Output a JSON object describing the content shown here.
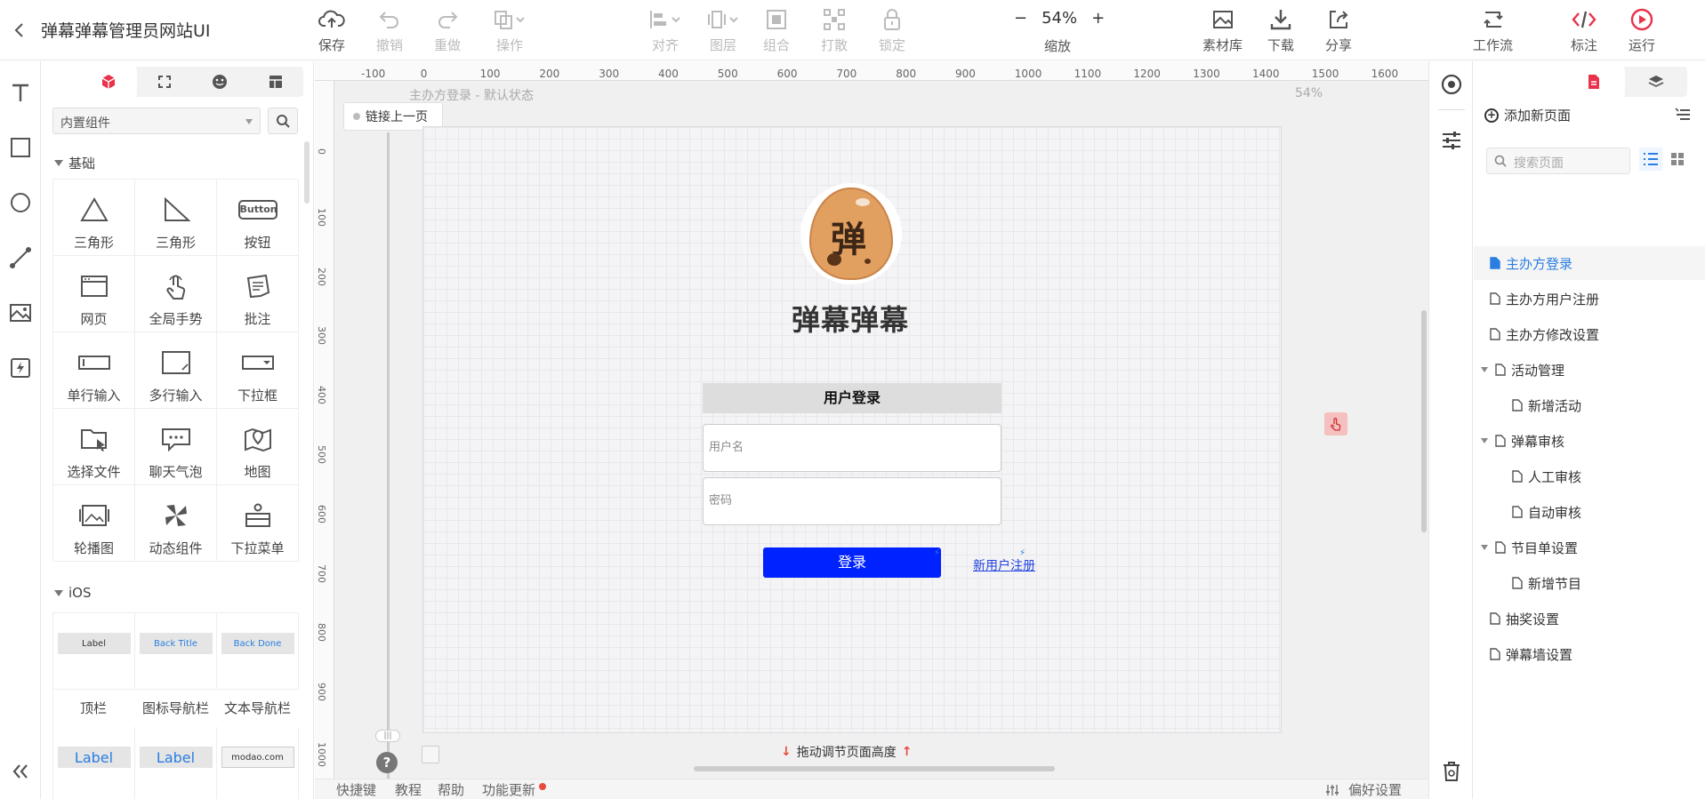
{
  "header": {
    "title": "弹幕弹幕管理员网站UI",
    "save": "保存",
    "undo": "撤销",
    "redo": "重做",
    "operate": "操作",
    "align": "对齐",
    "layer": "图层",
    "group": "组合",
    "ungroup": "打散",
    "lock": "锁定",
    "zoom_value": "54%",
    "zoom_label": "缩放",
    "assets": "素材库",
    "download": "下载",
    "share": "分享",
    "workflow": "工作流",
    "annotate": "标注",
    "run": "运行",
    "minus": "−",
    "plus": "+"
  },
  "library": {
    "select_value": "内置组件",
    "section_basic": "基础",
    "items": [
      {
        "label": "三角形",
        "icon": "triangle-icon"
      },
      {
        "label": "三角形",
        "icon": "right-triangle-icon"
      },
      {
        "label": "按钮",
        "icon": "button-icon"
      },
      {
        "label": "网页",
        "icon": "webpage-icon"
      },
      {
        "label": "全局手势",
        "icon": "gesture-icon"
      },
      {
        "label": "批注",
        "icon": "note-icon"
      },
      {
        "label": "单行输入",
        "icon": "input-icon"
      },
      {
        "label": "多行输入",
        "icon": "textarea-icon"
      },
      {
        "label": "下拉框",
        "icon": "select-icon"
      },
      {
        "label": "选择文件",
        "icon": "file-icon"
      },
      {
        "label": "聊天气泡",
        "icon": "chat-bubble-icon"
      },
      {
        "label": "地图",
        "icon": "map-icon"
      },
      {
        "label": "轮播图",
        "icon": "carousel-icon"
      },
      {
        "label": "动态组件",
        "icon": "dynamic-icon"
      },
      {
        "label": "下拉菜单",
        "icon": "dropdown-menu-icon"
      }
    ],
    "button_preview": "Button",
    "section_ios": "iOS",
    "ios_items": [
      {
        "label": "顶栏",
        "preview": "Label"
      },
      {
        "label": "图标导航栏",
        "preview": "Back  Title"
      },
      {
        "label": "文本导航栏",
        "preview": "Back  Done"
      }
    ],
    "ios_label_a": "Label",
    "ios_url": "modao.com"
  },
  "canvas": {
    "page_label": "主办方登录 - 默认状态",
    "page_zoom": "54%",
    "link_prev": "链接上一页",
    "hruler": [
      "-100",
      "0",
      "100",
      "200",
      "300",
      "400",
      "500",
      "600",
      "700",
      "800",
      "900",
      "1000",
      "1100",
      "1200",
      "1300",
      "1400",
      "1500",
      "1600"
    ],
    "vruler": [
      "0",
      "100",
      "200",
      "300",
      "400",
      "500",
      "600",
      "700",
      "800",
      "900",
      "1000"
    ],
    "brand": "弹幕弹幕",
    "logo_char": "弹",
    "login_header": "用户登录",
    "username_placeholder": "用户名",
    "password_placeholder": "密码",
    "login_button": "登录",
    "register_link": "新用户注册",
    "drag_tip": "拖动调节页面高度"
  },
  "bottombar": {
    "shortcuts": "快捷键",
    "tutorial": "教程",
    "help": "帮助",
    "updates": "功能更新",
    "prefs": "偏好设置"
  },
  "pages": {
    "add_page": "添加新页面",
    "search_placeholder": "搜索页面",
    "items": [
      {
        "label": "主办方登录",
        "level": 0,
        "selected": true,
        "group": false
      },
      {
        "label": "主办方用户注册",
        "level": 0,
        "selected": false,
        "group": false
      },
      {
        "label": "主办方修改设置",
        "level": 0,
        "selected": false,
        "group": false
      },
      {
        "label": "活动管理",
        "level": 0,
        "selected": false,
        "group": true
      },
      {
        "label": "新增活动",
        "level": 1,
        "selected": false,
        "group": false
      },
      {
        "label": "弹幕审核",
        "level": 0,
        "selected": false,
        "group": true
      },
      {
        "label": "人工审核",
        "level": 1,
        "selected": false,
        "group": false
      },
      {
        "label": "自动审核",
        "level": 1,
        "selected": false,
        "group": false
      },
      {
        "label": "节目单设置",
        "level": 0,
        "selected": false,
        "group": true
      },
      {
        "label": "新增节目",
        "level": 1,
        "selected": false,
        "group": false
      },
      {
        "label": "抽奖设置",
        "level": 0,
        "selected": false,
        "group": false
      },
      {
        "label": "弹幕墙设置",
        "level": 0,
        "selected": false,
        "group": false
      }
    ]
  },
  "colors": {
    "accent": "#2a7de1",
    "brand_red": "#e8334a",
    "login_blue": "#0022ff"
  }
}
